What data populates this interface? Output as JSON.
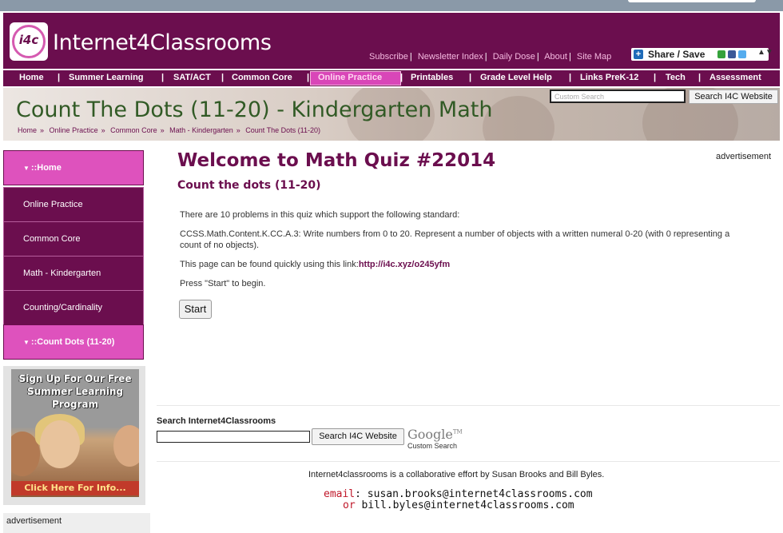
{
  "site": {
    "logo_mark": "i4c",
    "name": "Internet4Classrooms"
  },
  "top_links": [
    "Subscribe",
    "Newsletter Index",
    "Daily Dose",
    "About",
    "Site Map"
  ],
  "share": {
    "label": "Share / Save"
  },
  "nav": [
    "Home",
    "Summer Learning",
    "SAT/ACT",
    "Common Core",
    "Online Practice",
    "Printables",
    "Grade Level Help",
    "Links PreK-12",
    "Tech",
    "Assessment"
  ],
  "nav_active": "Online Practice",
  "banner": {
    "title": "Count The Dots (11-20) - Kindergarten Math",
    "breadcrumbs": [
      "Home",
      "Online Practice",
      "Common Core",
      "Math - Kindergarten",
      "Count The Dots (11-20)"
    ],
    "search_placeholder": "Custom Search",
    "search_button": "Search I4C Website"
  },
  "sidebar": {
    "items": [
      {
        "label": "::Home",
        "highlight": true
      },
      {
        "label": "Online Practice",
        "highlight": false
      },
      {
        "label": "Common Core",
        "highlight": false
      },
      {
        "label": "Math - Kindergarten",
        "highlight": false
      },
      {
        "label": "Counting/Cardinality",
        "highlight": false
      },
      {
        "label": "::Count Dots (11-20)",
        "highlight": true
      }
    ],
    "promo_top": "Sign Up For Our Free Summer Learning Program",
    "promo_bottom": "Click Here For Info...",
    "ad_label": "advertisement"
  },
  "main": {
    "ad_label": "advertisement",
    "title": "Welcome to Math Quiz #22014",
    "subtitle": "Count the dots (11-20)",
    "intro": "There are 10 problems in this quiz which support the following standard:",
    "standard_line1": "CCSS.Math.Content.K.CC.A.3: Write numbers from 0 to 20. Represent a number of objects with a written numeral 0-20 (with 0 representing a",
    "standard_line2": "count of no objects).",
    "link_prefix": "This page can be found quickly using this link:",
    "link": "http://i4c.xyz/o245yfm",
    "press_start": "Press \"Start\" to begin.",
    "start_button": "Start"
  },
  "bottom_search": {
    "label": "Search Internet4Classrooms",
    "button": "Search I4C Website",
    "google": "Google",
    "custom_search": "Custom Search"
  },
  "footer": {
    "text": "Internet4classrooms is a collaborative effort by Susan Brooks and Bill Byles.",
    "email_label": "email",
    "email1": ": susan.brooks@internet4classrooms.com",
    "or_label": "or",
    "email2": "bill.byles@internet4classrooms.com"
  }
}
